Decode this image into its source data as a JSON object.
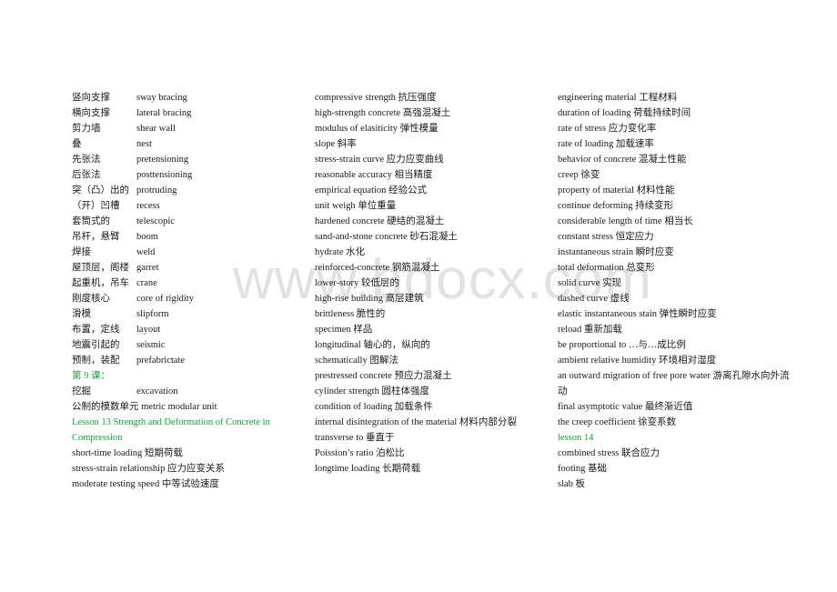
{
  "watermark": "www.bdocx.com",
  "colors": {
    "heading": "#1a9a3a",
    "text": "#1a1a1a",
    "watermark": "#d9d9d9"
  },
  "column1": {
    "pairs": [
      {
        "zh": "竖向支撑",
        "en": "sway bracing"
      },
      {
        "zh": "横向支撑",
        "en": "lateral bracing"
      },
      {
        "zh": "剪力墙",
        "en": "shear wall"
      },
      {
        "zh": "叠",
        "en": "nest"
      },
      {
        "zh": "先张法",
        "en": "pretensioning"
      },
      {
        "zh": "后张法",
        "en": "posttensioning"
      },
      {
        "zh": "突（凸）出的",
        "en": "protruding"
      },
      {
        "zh": "（开）凹槽",
        "en": "recess"
      },
      {
        "zh": "套筒式的",
        "en": "telescopic"
      },
      {
        "zh": "吊杆，悬臂",
        "en": "boom"
      },
      {
        "zh": "焊接",
        "en": "weld"
      },
      {
        "zh": "屋顶层，阁楼",
        "en": "garret"
      },
      {
        "zh": "起重机，吊车",
        "en": "crane"
      },
      {
        "zh": "刚度核心",
        "en": "core of rigidity"
      },
      {
        "zh": "滑模",
        "en": "slipform"
      },
      {
        "zh": "布置，定线",
        "en": "layout"
      },
      {
        "zh": "地震引起的",
        "en": "seismic"
      },
      {
        "zh": "预制，装配",
        "en": "prefabrictate"
      }
    ],
    "heading_lesson9": "第 9 课：",
    "excavation": {
      "zh": "挖掘",
      "en": "excavation"
    },
    "metric_modular": "公制的模数单元  metric modular unit",
    "heading_lesson13": "Lesson 13 Strength and Deformation of Concrete in Compression",
    "entries": [
      "short-time loading  短期荷载",
      "stress-strain relationship  应力应变关系",
      "moderate testing speed  中等试验速度"
    ]
  },
  "column2": {
    "entries": [
      "compressive strength  抗压强度",
      "high-strength concrete  高强混凝土",
      "modulus of elasiticity  弹性模量",
      "slope  斜率",
      "stress-strain curve  应力应变曲线",
      "reasonable accuracy  相当精度",
      "empirical equation  经验公式",
      "unit weigh  单位重量",
      "hardened concrete  硬结的混凝土",
      "sand-and-stone concrete 砂石混凝土",
      "hydrate  水化",
      "reinforced-concrete  钢筋混凝土",
      "lower-story 较低层的",
      "high-rise building  高层建筑",
      "brittleness  脆性的",
      "specimen  样品",
      "longitudinal  轴心的，纵向的",
      "schematically  图解法",
      "prestressed concrete  预应力混凝土",
      "cylinder strength  圆柱体强度",
      "condition of loading  加载条件",
      "internal disintegration of the material  材料内部分裂",
      "transverse to  垂直于",
      "Poission’s ratio  泊松比",
      "longtime loading  长期荷载"
    ]
  },
  "column3": {
    "entries_before": [
      "engineering material  工程材料",
      "duration of loading  荷载持续时间",
      "rate of stress  应力变化率",
      "rate of loading  加载速率",
      "behavior of concrete  混凝土性能",
      "creep  徐变",
      "property of material  材料性能",
      "continue deforming  持续变形",
      "considerable length of time  相当长",
      "constant stress  恒定应力",
      "instantaneous strain  瞬时应变",
      "total deformation  总变形",
      "solid curve  实现",
      "dashed curve  虚线",
      "elastic instantaneous stain  弹性瞬时应变",
      "reload  重新加载",
      "be proportional to …与…成比例",
      "ambient relative humidity  环境相对湿度",
      "an outward migration of free pore water  游离孔隙水向外流动",
      "final asymptotic value  最终渐近值",
      "the creep coefficient  徐变系数"
    ],
    "heading_lesson14": "lesson 14",
    "entries_after": [
      "combined stress  联合应力",
      "footing  基础",
      "slab  板"
    ]
  }
}
